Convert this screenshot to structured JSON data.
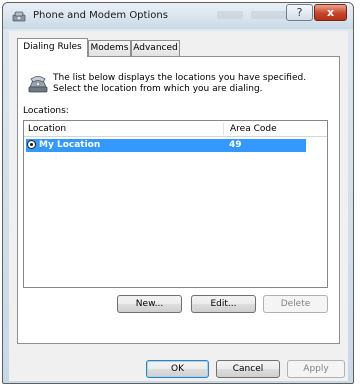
{
  "window": {
    "title": "Phone and Modem Options",
    "help_glyph": "?",
    "close_glyph": "x"
  },
  "tabs": [
    {
      "label": "Dialing Rules",
      "active": true
    },
    {
      "label": "Modems",
      "active": false
    },
    {
      "label": "Advanced",
      "active": false
    }
  ],
  "panel": {
    "intro_text": "The list below displays the locations you have specified. Select the location from which you are dialing.",
    "locations_label": "Locations:",
    "columns": {
      "location": "Location",
      "area_code": "Area Code"
    },
    "rows": [
      {
        "location": "My Location",
        "area_code": "49",
        "selected": true
      }
    ],
    "buttons": {
      "new": "New...",
      "edit": "Edit...",
      "delete": "Delete"
    }
  },
  "footer": {
    "ok": "OK",
    "cancel": "Cancel",
    "apply": "Apply"
  },
  "colors": {
    "selection": "#3399ff",
    "close": "#c7452b"
  },
  "icons": {
    "app": "phone-modem-icon",
    "info": "telephone-icon"
  }
}
